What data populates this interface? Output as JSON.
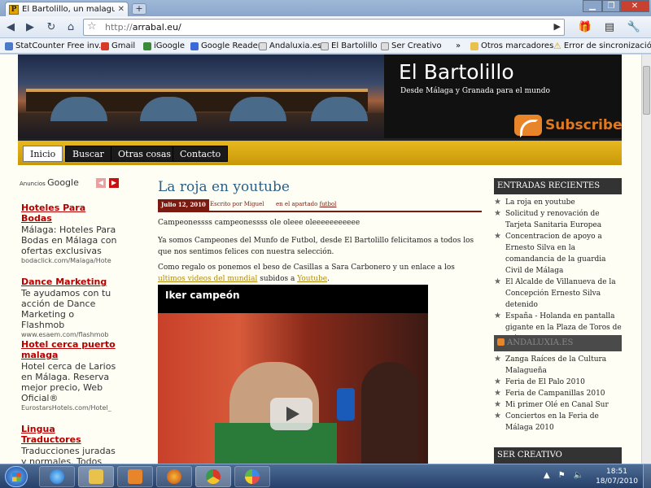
{
  "browser": {
    "tab_title": "El Bartolillo, un malague...",
    "favicon_letter": "P",
    "url_scheme": "http://",
    "url_rest": "arrabal.eu/"
  },
  "bookmarks": [
    {
      "label": "StatCounter Free inv...",
      "color": "#4a7ac8"
    },
    {
      "label": "Gmail",
      "color": "#d83a2a"
    },
    {
      "label": "iGoogle",
      "color": "#3a8a3a"
    },
    {
      "label": "Google Reader",
      "color": "#3a6ad8"
    },
    {
      "label": "Andaluxia.es",
      "color": "#888888"
    },
    {
      "label": "El Bartolillo",
      "color": "#999999"
    },
    {
      "label": "Ser Creativo",
      "color": "#999999"
    }
  ],
  "bookmarks_right": {
    "other": "Otros marcadores",
    "sync_error": "Error de sincronización"
  },
  "site": {
    "title": "El Bartolillo",
    "description": "Desde Málaga y Granada para el mundo",
    "subscribe": "Subscribe"
  },
  "nav": [
    "Inicio",
    "Buscar",
    "Otras cosas",
    "Contacto"
  ],
  "ads": {
    "label": "Anuncios",
    "brand": "Google",
    "items": [
      {
        "title": "Hoteles Para Bodas",
        "body": "Málaga: Hoteles Para Bodas en Málaga con ofertas exclusivas",
        "url": "bodaclick.com/Malaga/Hote"
      },
      {
        "title": "Dance Marketing",
        "body": "Te ayudamos con tu acción de Dance Marketing o Flashmob",
        "url": "www.esaem.com/flashmob"
      },
      {
        "title": "Hotel cerca puerto malaga",
        "body": "Hotel cerca de Larios en Málaga. Reserva mejor precio, Web Oficial®",
        "url": "EurostarsHotels.com/Hotel_"
      },
      {
        "title": "Lingua Traductores",
        "body": "Traducciones juradas y normales. Todos los idiomas a buen precio.",
        "url": ""
      }
    ]
  },
  "post": {
    "title": "La roja en youtube",
    "date": "Julio 12, 2010",
    "author": "Escrito por Miguel",
    "category_prefix": "en el apartado",
    "category": "futbol",
    "p1": "Campeonessss campeonessss ole oleee oleeeeeeeeeee",
    "p2": "Ya somos Campeones del Munfo de Futbol, desde El Bartolillo felicitamos a todos los que nos sentimos felices con nuestra selección.",
    "p3_a": "Como regalo os ponemos el beso de Casillas a Sara Carbonero y un enlace a los ",
    "p3_link1": "ultimos videos del mundial",
    "p3_b": " subidos a ",
    "p3_link2": "Youtube",
    "p3_c": ".",
    "video_title": "Iker campeón"
  },
  "sidebar": {
    "recent_heading": "ENTRADAS RECIENTES",
    "recent": [
      "La roja en youtube",
      "Solicitud y renovación de Tarjeta Sanitaria Europea",
      "Concentracion de apoyo a Ernesto Silva en la comandancia de la guardia Civil de Málaga",
      "El Alcalde de Villanueva de la Concepción Ernesto Silva detenido",
      "España - Holanda en pantalla gigante en la Plaza de Toros de Málaga"
    ],
    "andaluxia_heading": "ANDALUXIA.ES",
    "andaluxia": [
      "Zanga Raíces de la Cultura Malagueña",
      "Feria de El Palo 2010",
      "Feria de Campanillas 2010",
      "Mi primer Olé en Canal Sur",
      "Conciertos en la Feria de Málaga 2010"
    ],
    "creativo_heading": "SER CREATIVO"
  },
  "taskbar": {
    "time": "18:51",
    "date": "18/07/2010"
  }
}
